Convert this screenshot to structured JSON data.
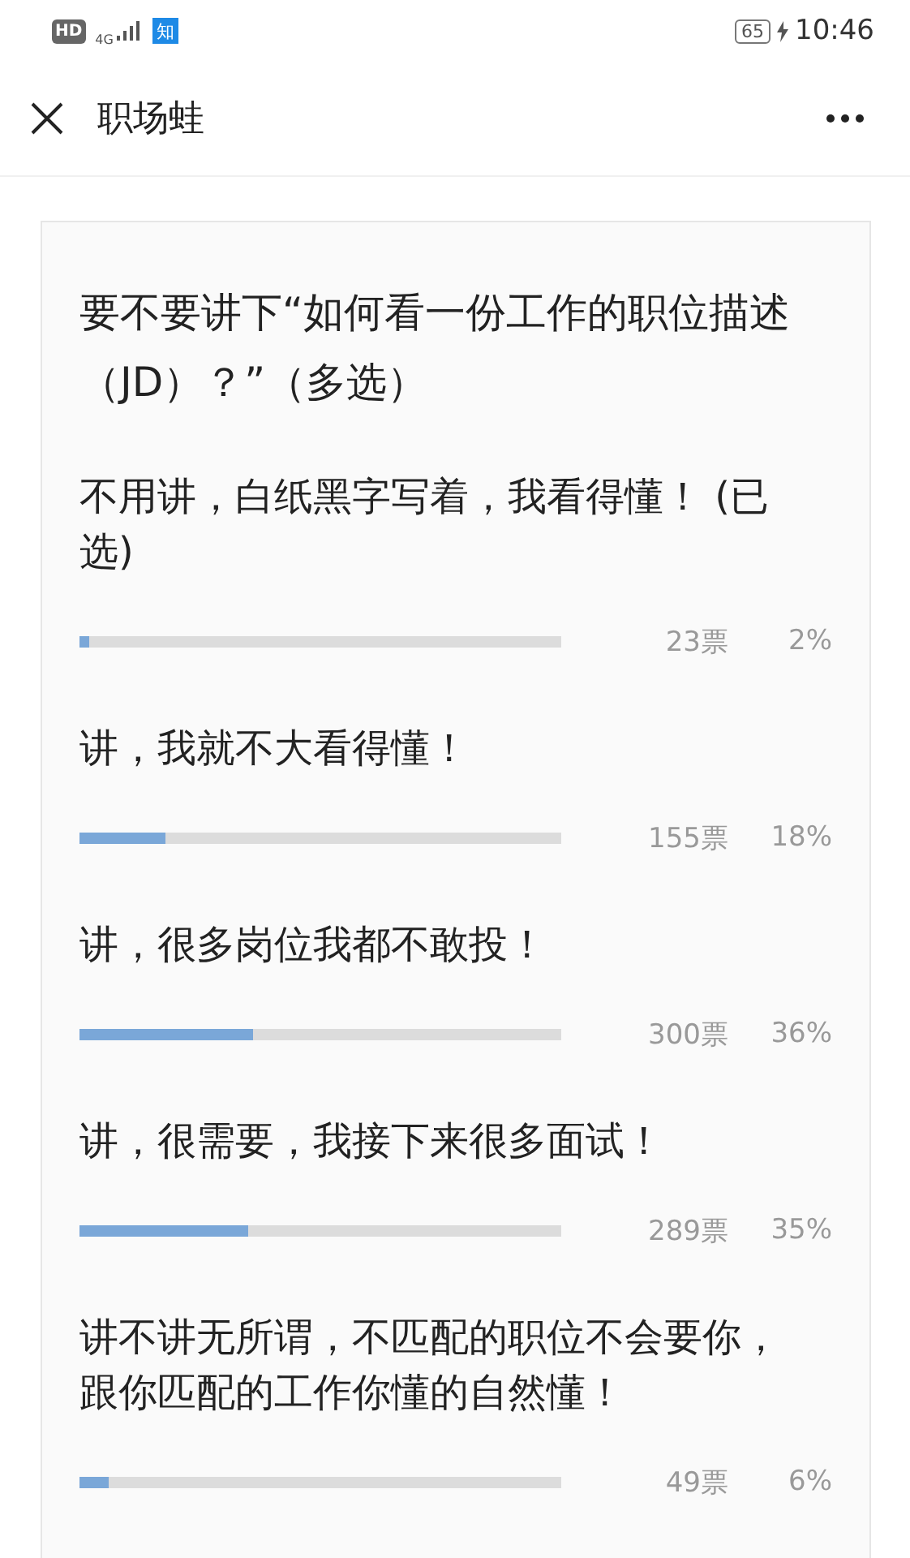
{
  "status_bar": {
    "hd": "HD",
    "network": "4G",
    "app_badge": "知",
    "battery": "65",
    "time": "10:46"
  },
  "header": {
    "title": "职场蛙"
  },
  "poll": {
    "question": "要不要讲下“如何看一份工作的职位描述（JD）？”（多选）",
    "options": [
      {
        "text": "不用讲，白纸黑字写着，我看得懂！ (已选)",
        "votes": "23票",
        "percent": "2%",
        "level": 0.02
      },
      {
        "text": "讲，我就不大看得懂！",
        "votes": "155票",
        "percent": "18%",
        "level": 0.18
      },
      {
        "text": "讲，很多岗位我都不敢投！",
        "votes": "300票",
        "percent": "36%",
        "level": 0.36
      },
      {
        "text": "讲，很需要，我接下来很多面试！",
        "votes": "289票",
        "percent": "35%",
        "level": 0.35
      },
      {
        "text": "讲不讲无所谓，不匹配的职位不会要你，跟你匹配的工作你懂的自然懂！",
        "votes": "49票",
        "percent": "6%",
        "level": 0.06
      }
    ]
  }
}
